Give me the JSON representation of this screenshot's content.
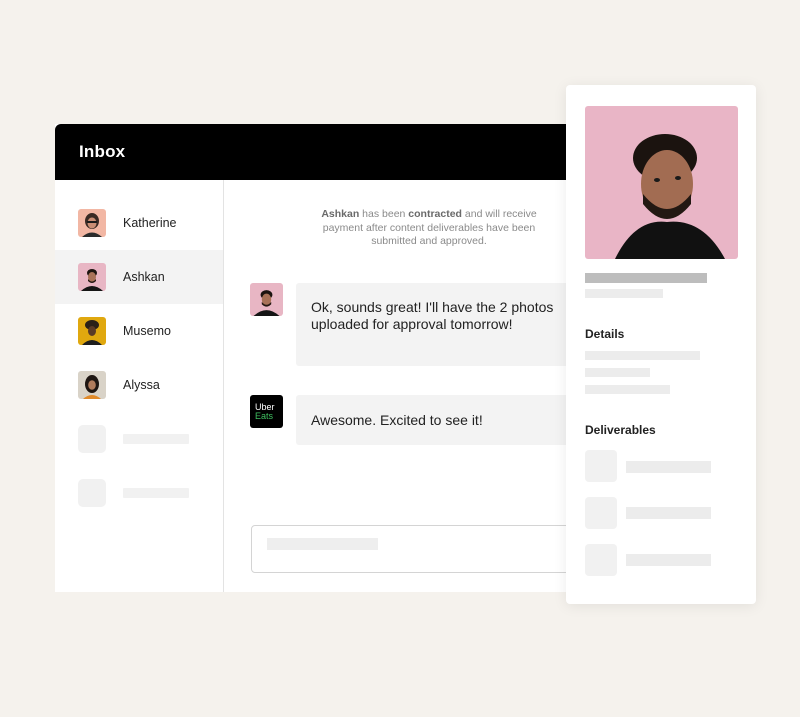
{
  "inbox": {
    "title": "Inbox",
    "contacts": [
      {
        "name": "Katherine",
        "avatar": "katherine-avatar"
      },
      {
        "name": "Ashkan",
        "avatar": "ashkan-avatar",
        "active": true
      },
      {
        "name": "Musemo",
        "avatar": "musemo-avatar"
      },
      {
        "name": "Alyssa",
        "avatar": "alyssa-avatar"
      }
    ]
  },
  "chat": {
    "system_message": {
      "name": "Ashkan",
      "text_1": " has been ",
      "status": "contracted",
      "text_2": " and will receive payment after content deliverables have been submitted and approved."
    },
    "messages": [
      {
        "sender": "Ashkan",
        "avatar": "ashkan-avatar",
        "text": "Ok, sounds great! I'll have the 2 photos uploaded for approval tomorrow!"
      },
      {
        "sender": "Uber Eats",
        "avatar": "uber-eats-logo",
        "logo_line1": "Uber",
        "logo_line2": "Eats",
        "text": "Awesome. Excited to see it!"
      }
    ]
  },
  "profile": {
    "photo": "ashkan-profile-photo",
    "details_title": "Details",
    "deliverables_title": "Deliverables"
  },
  "colors": {
    "background": "#f5f2ed",
    "header": "#000000",
    "bubble": "#f3f3f3",
    "uber_green": "#3fc060",
    "skeleton": "#ececec"
  }
}
